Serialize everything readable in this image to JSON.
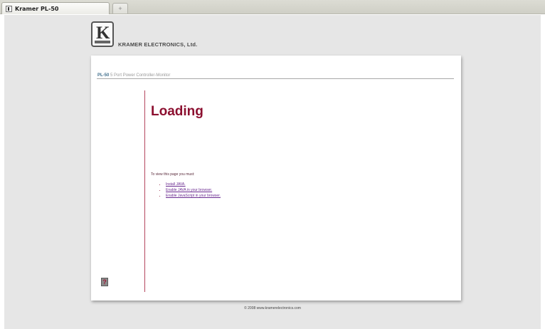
{
  "browser": {
    "tab_title": "Kramer PL-50",
    "new_tab_label": "+"
  },
  "header": {
    "logo_letter": "K",
    "brand_name": "KRAMER ELECTRONICS, Ltd."
  },
  "card": {
    "model": "PL-50",
    "subtitle": "5 Port Power Controller-Monitor",
    "loading_title": "Loading",
    "instructions": "To view this page you must:",
    "requirements": [
      "Install JAVA.",
      "Enable JAVA in your browser.",
      "Enable JavaScript in your browser."
    ],
    "help_label": "?"
  },
  "footer": {
    "copyright": "© 2008 www.kramerelectronics.com"
  },
  "colors": {
    "accent": "#8c1030",
    "model": "#3f6e8c",
    "background": "#e6e6e6"
  }
}
